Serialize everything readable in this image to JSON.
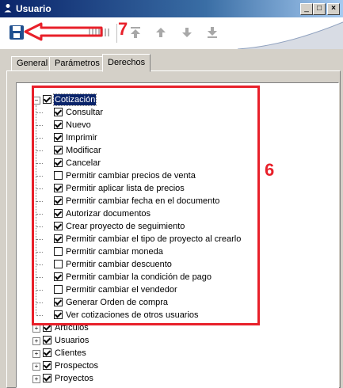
{
  "window": {
    "title": "Usuario",
    "controls": {
      "minimize": "_",
      "maximize": "□",
      "close": "×"
    }
  },
  "toolbar": {
    "save_icon": "floppy-disk-icon",
    "buttons": [
      "move-first-icon",
      "move-up-icon",
      "move-down-icon",
      "move-last-icon"
    ]
  },
  "tabs": [
    {
      "label": "General",
      "active": false
    },
    {
      "label": "Parámetros",
      "active": false
    },
    {
      "label": "Derechos",
      "active": true
    }
  ],
  "tree": {
    "expanded": {
      "label": "Cotización",
      "checked": true,
      "selected": true,
      "children": [
        {
          "label": "Consultar",
          "checked": true
        },
        {
          "label": "Nuevo",
          "checked": true
        },
        {
          "label": "Imprimir",
          "checked": true
        },
        {
          "label": "Modificar",
          "checked": true
        },
        {
          "label": "Cancelar",
          "checked": true
        },
        {
          "label": "Permitir cambiar precios de venta",
          "checked": false
        },
        {
          "label": "Permitir aplicar lista de precios",
          "checked": true
        },
        {
          "label": "Permitir cambiar fecha en el documento",
          "checked": true
        },
        {
          "label": "Autorizar documentos",
          "checked": true
        },
        {
          "label": "Crear proyecto de seguimiento",
          "checked": true
        },
        {
          "label": "Permitir cambiar el tipo de proyecto al crearlo",
          "checked": true
        },
        {
          "label": "Permitir cambiar moneda",
          "checked": false
        },
        {
          "label": "Permitir cambiar descuento",
          "checked": false
        },
        {
          "label": "Permitir cambiar la condición de pago",
          "checked": true
        },
        {
          "label": "Permitir cambiar el vendedor",
          "checked": false
        },
        {
          "label": "Generar Orden de compra",
          "checked": true
        },
        {
          "label": "Ver cotizaciones de otros usuarios",
          "checked": true
        }
      ]
    },
    "collapsed": [
      {
        "label": "Artículos",
        "checked": true
      },
      {
        "label": "Usuarios",
        "checked": true
      },
      {
        "label": "Clientes",
        "checked": true
      },
      {
        "label": "Prospectos",
        "checked": true
      },
      {
        "label": "Proyectos",
        "checked": true
      }
    ]
  },
  "annotations": {
    "step7": "7",
    "step6": "6",
    "color": "#e8202a"
  }
}
